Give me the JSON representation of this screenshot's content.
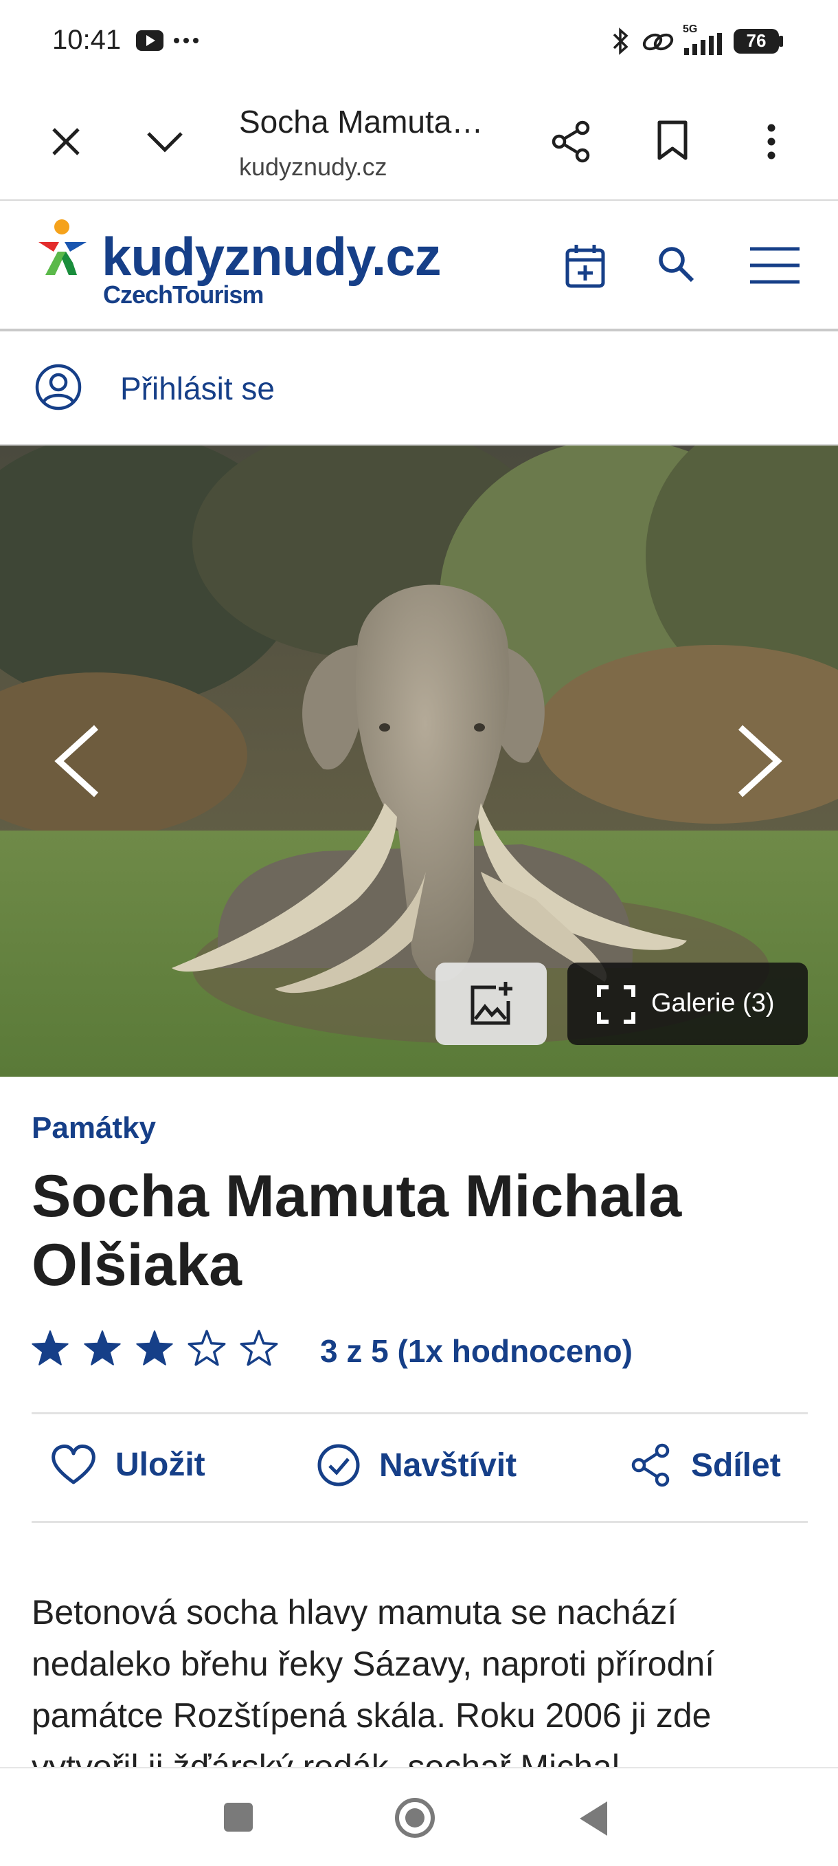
{
  "status": {
    "time": "10:41",
    "battery": "76",
    "network": "5G"
  },
  "browser": {
    "title": "Socha Mamuta…",
    "url": "kudyznudy.cz"
  },
  "site": {
    "brand": "kudyznudy.cz",
    "sub": "CzechTourism"
  },
  "login": {
    "label": "Přihlásit se"
  },
  "gallery": {
    "label": "Galerie (3)"
  },
  "article": {
    "category": "Památky",
    "title": "Socha Mamuta Michala Olšiaka",
    "rating_value": 3,
    "rating_max": 5,
    "rating_text": "3 z 5 (1x hodnoceno)",
    "description": "Betonová socha hlavy mamuta se nachází nedaleko břehu řeky Sázavy, naproti přírodní památce Rozštípená skála. Roku 2006 ji zde vytvořil ji žďárský rodák, sochař Michal"
  },
  "actions": {
    "save": "Uložit",
    "visit": "Navštívit",
    "share": "Sdílet"
  },
  "colors": {
    "brand": "#163f88",
    "text": "#1f1f1f"
  }
}
